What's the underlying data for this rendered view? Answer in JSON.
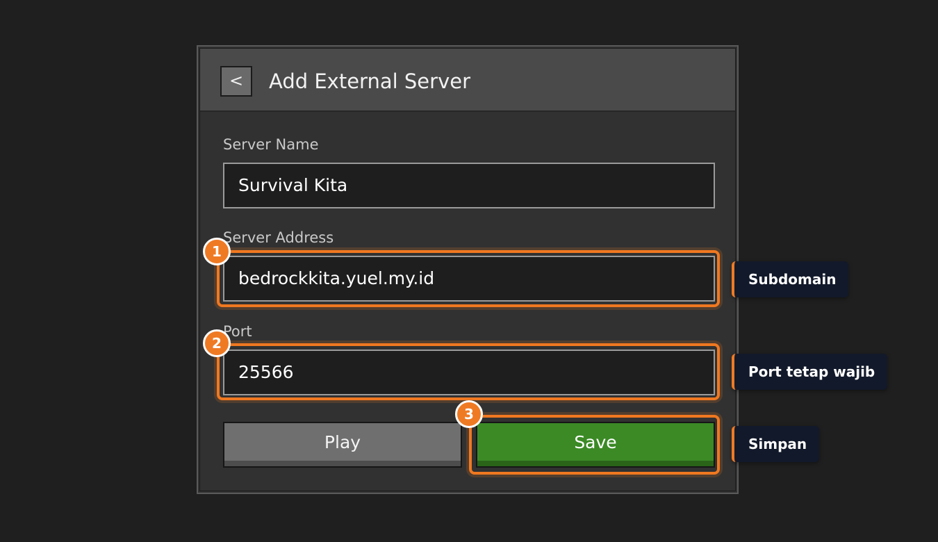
{
  "dialog": {
    "back_label": "<",
    "title": "Add External Server"
  },
  "fields": {
    "server_name": {
      "label": "Server Name",
      "value": "Survival Kita"
    },
    "server_address": {
      "label": "Server Address",
      "value": "bedrockkita.yuel.my.id"
    },
    "port": {
      "label": "Port",
      "value": "25566"
    }
  },
  "buttons": {
    "play_label": "Play",
    "save_label": "Save"
  },
  "annotations": {
    "badges": [
      "1",
      "2",
      "3"
    ],
    "callouts": [
      "Subdomain",
      "Port tetap wajib",
      "Simpan"
    ],
    "accent_color": "#ef7a24"
  },
  "colors": {
    "background": "#1f1f1f",
    "panel": "#313131",
    "header": "#4a4a4a",
    "save_button": "#3b8a26",
    "play_button": "#6f6f6f"
  }
}
